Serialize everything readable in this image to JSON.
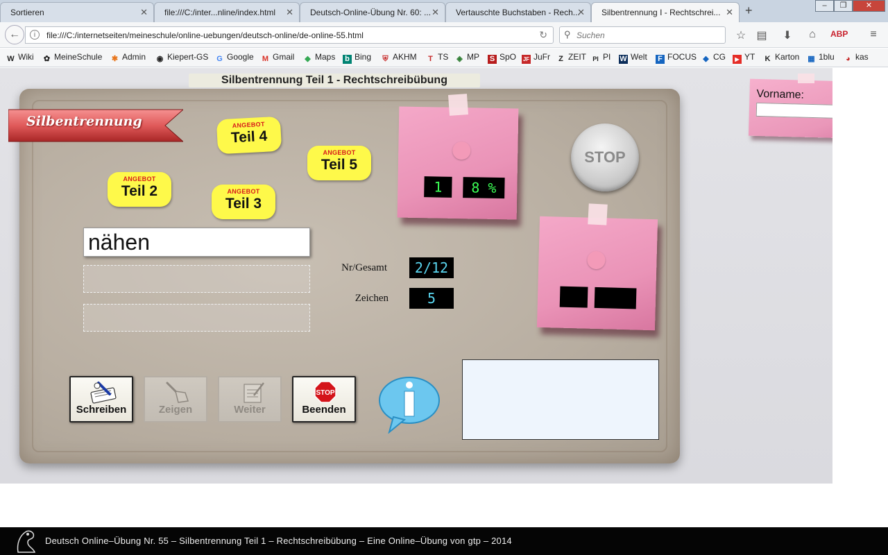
{
  "browser": {
    "tabs": [
      {
        "label": "Sortieren",
        "active": false
      },
      {
        "label": "file:///C:/inter...nline/index.html",
        "active": false
      },
      {
        "label": "Deutsch-Online-Übung Nr. 60: ...",
        "active": false
      },
      {
        "label": "Vertauschte Buchstaben - Rech...",
        "active": false
      },
      {
        "label": "Silbentrennung I - Rechtschrei...",
        "active": true
      }
    ],
    "new_tab": "+",
    "window_controls": {
      "minimize": "–",
      "restore": "❐",
      "close": "✕"
    },
    "url": "file:///C:/internetseiten/meineschule/online-uebungen/deutsch-online/de-online-55.html",
    "search_placeholder": "Suchen",
    "bookmarks": [
      {
        "label": "Wiki",
        "icon": "W"
      },
      {
        "label": "MeineSchule",
        "icon": "✿"
      },
      {
        "label": "Admin",
        "icon": "✱"
      },
      {
        "label": "Kiepert-GS",
        "icon": "◉"
      },
      {
        "label": "Google",
        "icon": "G"
      },
      {
        "label": "Gmail",
        "icon": "M"
      },
      {
        "label": "Maps",
        "icon": "◆"
      },
      {
        "label": "Bing",
        "icon": "b"
      },
      {
        "label": "AKHM",
        "icon": "⛨"
      },
      {
        "label": "TS",
        "icon": "T"
      },
      {
        "label": "MP",
        "icon": "◈"
      },
      {
        "label": "SpO",
        "icon": "S"
      },
      {
        "label": "JuFr",
        "icon": "JF"
      },
      {
        "label": "ZEIT",
        "icon": "Z"
      },
      {
        "label": "PI",
        "icon": "PI"
      },
      {
        "label": "Welt",
        "icon": "W"
      },
      {
        "label": "FOCUS",
        "icon": "F"
      },
      {
        "label": "CG",
        "icon": "◆"
      },
      {
        "label": "YT",
        "icon": "▶"
      },
      {
        "label": "Karton",
        "icon": "K"
      },
      {
        "label": "1blu",
        "icon": "▦"
      },
      {
        "label": "kas",
        "icon": "◕"
      }
    ]
  },
  "exercise": {
    "title": "Silbentrennung Teil 1 - Rechtschreibübung",
    "ribbon_text": "Silbentrennung",
    "offer_tag_top": "ANGEBOT",
    "offer_tags": [
      "Teil 4",
      "Teil 5",
      "Teil 2",
      "Teil 3"
    ],
    "current_word": "nähen",
    "answer_fields": [
      "",
      ""
    ],
    "nr_gesamt_label": "Nr/Gesamt",
    "nr_gesamt_value": "2/12",
    "zeichen_label": "Zeichen",
    "zeichen_value": "5",
    "score_note": {
      "count": "1",
      "percent": "8 %"
    },
    "result_note": {
      "left": "",
      "right": ""
    },
    "stop_label": "STOP",
    "buttons": [
      {
        "label": "Schreiben",
        "enabled": true
      },
      {
        "label": "Zeigen",
        "enabled": false
      },
      {
        "label": "Weiter",
        "enabled": false
      },
      {
        "label": "Beenden",
        "enabled": true
      }
    ],
    "stop_sign_text": "STOP",
    "info_icon": "i",
    "feedback_text": "",
    "vorname_label": "Vorname:",
    "vorname_value": ""
  },
  "footer": {
    "text": "Deutsch Online–Übung Nr. 55 – Silbentrennung Teil 1 – Rechtschreibübung – Eine Online–Übung von gtp – 2014"
  },
  "colors": {
    "offer_yellow": "#fef94a",
    "note_pink": "#ea93b7",
    "lcd_green": "#3cff55",
    "lcd_cyan": "#5ad6f0"
  }
}
